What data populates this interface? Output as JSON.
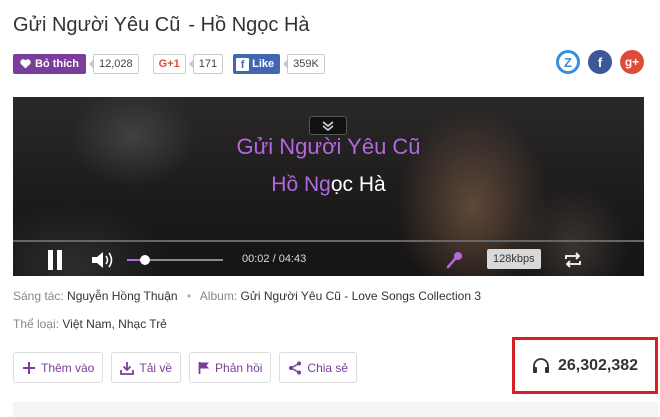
{
  "song": {
    "title": "Gửi Người Yêu Cũ",
    "artist": "- Hồ Ngọc Hà"
  },
  "social": {
    "like_label": "Bỏ thích",
    "like_count": "12,028",
    "gplus_label": "G+1",
    "gplus_count": "171",
    "fb_label": "Like",
    "fb_count": "359K"
  },
  "share_icons": {
    "zalo": "Z",
    "facebook": "f",
    "gplus": "g+"
  },
  "player": {
    "lyric_line1": "Gửi Người Yêu Cũ",
    "lyric_line2_sung": "Hồ Ng",
    "lyric_line2_rest": "ọc Hà",
    "time": "00:02 / 04:43",
    "quality": "128kbps",
    "volume": 0.19,
    "accent": "#b367e0"
  },
  "meta": {
    "composer_label": "Sáng tác:",
    "composer": "Nguyễn Hồng Thuận",
    "album_label": "Album:",
    "album": "Gửi Người Yêu Cũ - Love Songs Collection 3",
    "genre_label": "Thể loại:",
    "genre": "Việt Nam, Nhạc Trẻ"
  },
  "actions": {
    "add": "Thêm vào",
    "download": "Tải về",
    "feedback": "Phản hồi",
    "share": "Chia sẻ"
  },
  "listens": {
    "count": "26,302,382",
    "highlight": "#d42027"
  }
}
